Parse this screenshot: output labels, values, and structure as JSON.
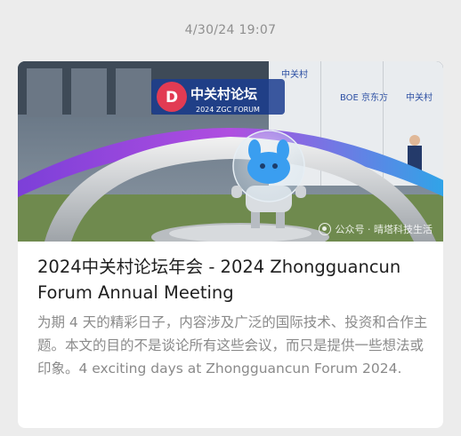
{
  "timestamp": "4/30/24 19:07",
  "card": {
    "title": "2024中关村论坛年会 - 2024 Zhongguancun Forum Annual Meeting",
    "description": "为期 4 天的精彩日子，内容涉及广泛的国际技术、投资和合作主题。本文的目的不是谈论所有这些会议，而只是提供一些想法或印象。4 exciting days at Zhongguancun Forum 2024.",
    "image": {
      "sign_text": "中关村论坛",
      "sign_subtext": "2024 ZGC FORUM",
      "backdrop_logos": [
        "中关村",
        "BOE 京东方",
        "中关村"
      ],
      "watermark": "公众号 · 晴塔科技生活"
    }
  },
  "colors": {
    "page_background": "#ececec",
    "card_background": "#ffffff",
    "title_text": "#1f1f1f",
    "description_text": "#8a8a8a",
    "timestamp_text": "#8f8f8f",
    "ring_gradient_start": "#7a3fd8",
    "ring_gradient_end": "#2aa8e8",
    "mascot_blue": "#3a9ef0"
  }
}
